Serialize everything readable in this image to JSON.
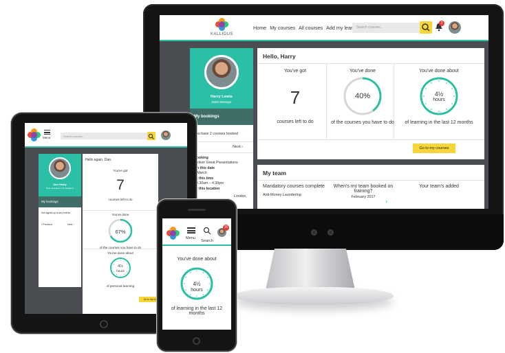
{
  "brand": {
    "name": "KALLIDUS"
  },
  "colors": {
    "teal": "#2bbfa5",
    "dark_teal": "#3f6e68",
    "yellow": "#f8d63a",
    "badge_red": "#e53935",
    "page_bg": "#4a4d52"
  },
  "desktop": {
    "nav": {
      "home": "Home",
      "my_courses": "My courses",
      "all_courses": "All courses",
      "add_learning": "Add my learning"
    },
    "search_placeholder": "Search courses...",
    "notification_count": "2",
    "profile": {
      "name": "Harry Lewis",
      "role": "Sales Manager"
    },
    "bookings": {
      "title": "My bookings",
      "summary": "You have 2 courses booked",
      "next": "Next",
      "booking_label": "Booking",
      "booking_value": "Deliver Great Presentations",
      "date_label": "On this date",
      "date_value": "6 March",
      "time_label": "At this time",
      "time_value": "10.30am – 4.30pm",
      "location_label": "At this location",
      "location_value": "London,"
    },
    "hello": {
      "title": "Hello, Harry",
      "col1_heading": "You've got",
      "col1_value": "7",
      "col1_caption": "courses left to do",
      "col2_heading": "You've done",
      "col2_value": "40%",
      "col2_progress": 0.4,
      "col2_caption": "of the courses you have to do",
      "col3_heading": "You've done about",
      "col3_value": "4½",
      "col3_unit": "hours",
      "col3_caption": "of learning in the last 12 months",
      "button": "Go to my courses"
    },
    "team": {
      "title": "My team",
      "col1_heading": "Mandatory courses complete",
      "col1_item": "Anti-Money Laundering",
      "col2_heading": "When's my team booked on training?",
      "col2_item": "February 2017",
      "col3_heading": "Your team's added"
    }
  },
  "tablet": {
    "menu_label": "Menu",
    "search_placeholder": "Search courses...",
    "profile": {
      "name": "Dan Healy",
      "role": "Peer developer (UX designer)"
    },
    "bookings_title": "My bookings",
    "bookings_summary": "Not signed up to any events",
    "previous": "Previous",
    "next": "Next",
    "greeting": "Hello again, Dan.",
    "col1_heading": "You've got",
    "col1_value": "7",
    "col1_caption": "courses left to do",
    "col2_heading": "You've done",
    "col2_value": "67%",
    "col2_progress": 0.67,
    "col2_caption": "of the courses you have to do",
    "col3_heading": "You've done about",
    "col3_value": "4½",
    "col3_unit": "hours",
    "col3_caption": "of personal learning",
    "button": "Go to my courses"
  },
  "phone": {
    "menu_label": "Menu",
    "search_label": "Search",
    "notification_count": "10",
    "heading": "You've done about",
    "value": "4½",
    "unit": "hours",
    "caption": "of learning in the last 12 months"
  }
}
